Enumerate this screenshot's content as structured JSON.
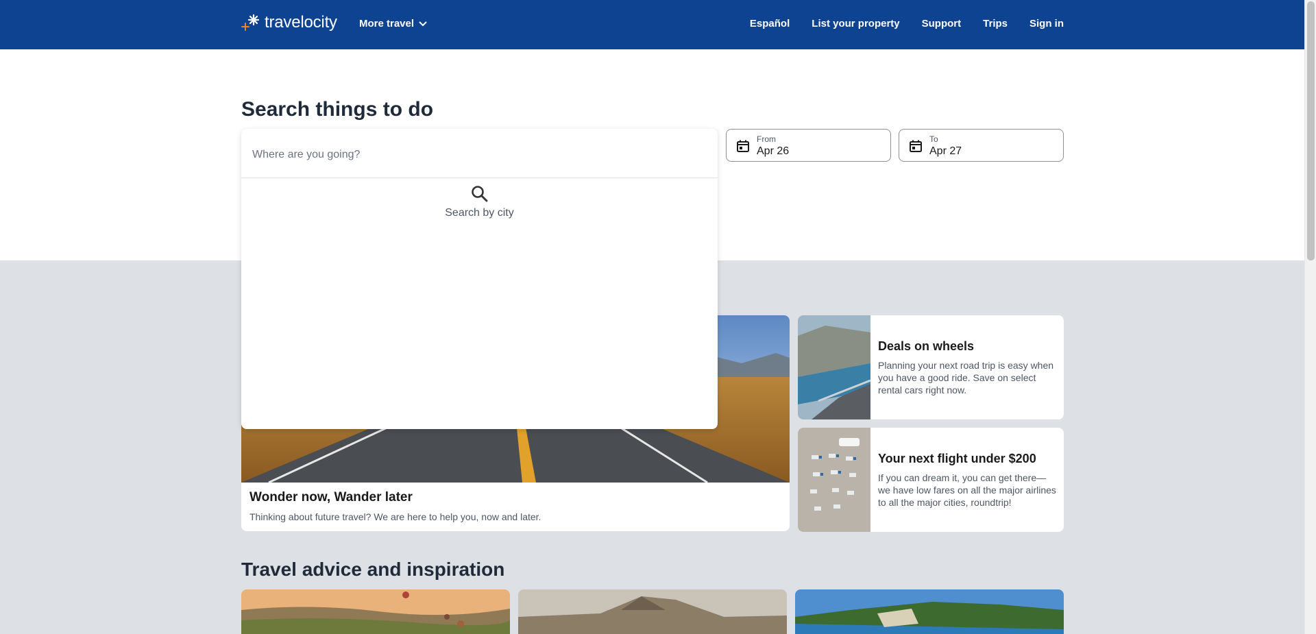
{
  "header": {
    "logo_text": "travelocity",
    "more_travel": "More travel",
    "nav": [
      "Español",
      "List your property",
      "Support",
      "Trips",
      "Sign in"
    ]
  },
  "search": {
    "title": "Search things to do",
    "destination_placeholder": "Where are you going?",
    "empty_hint": "Search by city",
    "from_label": "From",
    "from_value": "Apr 26",
    "to_label": "To",
    "to_value": "Apr 27"
  },
  "promos": {
    "hero": {
      "title": "Wonder now, Wander later",
      "description": "Thinking about future travel? We are here to help you, now and later."
    },
    "cards": [
      {
        "title": "Deals on wheels",
        "description": "Planning your next road trip is easy when you have a good ride. Save on select rental cars right now."
      },
      {
        "title": "Your next flight under $200",
        "description": "If you can dream it, you can get there—we have low fares on all the major airlines to all the major cities, roundtrip!"
      }
    ]
  },
  "advice": {
    "title": "Travel advice and inspiration"
  },
  "colors": {
    "header_bg": "#0e4391",
    "band_bg": "#dde0e4",
    "logo_accent": "#f4861f"
  }
}
